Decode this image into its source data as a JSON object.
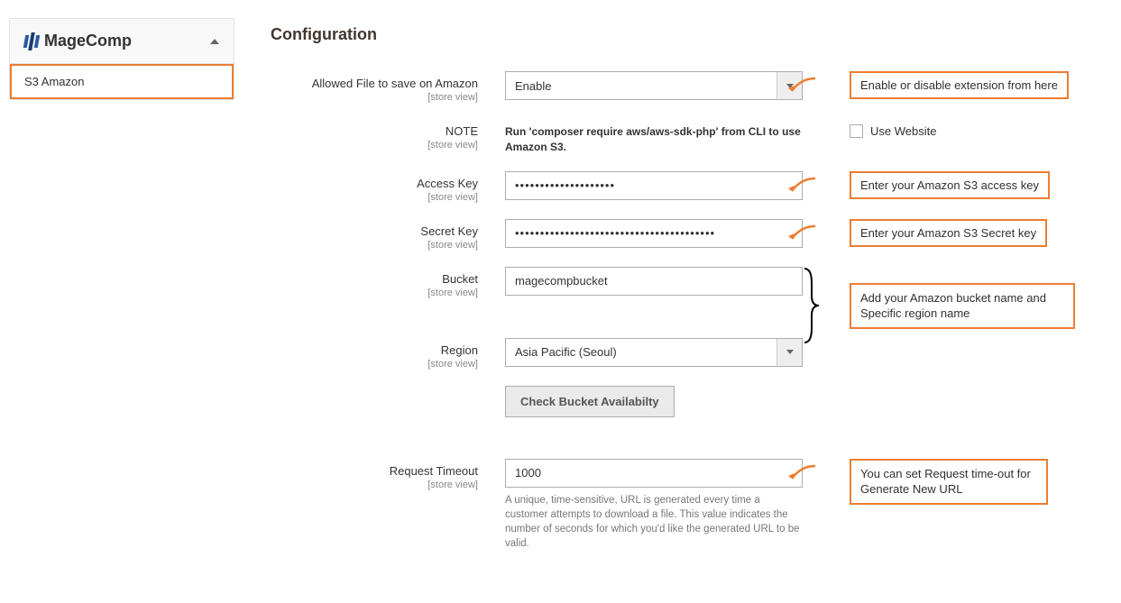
{
  "sidebar": {
    "brand_label": "MageComp",
    "items": [
      {
        "label": "S3 Amazon"
      }
    ]
  },
  "page": {
    "title": "Configuration"
  },
  "scope_text": "[store view]",
  "fields": {
    "allowed": {
      "label": "Allowed File to save on Amazon",
      "value": "Enable",
      "callout": "Enable or disable extension from here"
    },
    "note": {
      "label": "NOTE",
      "text": "Run 'composer require aws/aws-sdk-php' from CLI to use Amazon S3.",
      "use_website_label": "Use Website"
    },
    "access_key": {
      "label": "Access Key",
      "value": "••••••••••••••••••••",
      "callout": "Enter your Amazon S3 access key"
    },
    "secret_key": {
      "label": "Secret Key",
      "value": "••••••••••••••••••••••••••••••••••••••••",
      "callout": "Enter your Amazon S3 Secret key"
    },
    "bucket": {
      "label": "Bucket",
      "value": "magecompbucket"
    },
    "region": {
      "label": "Region",
      "value": "Asia Pacific (Seoul)"
    },
    "bucket_region_callout": "Add your Amazon bucket name and Specific region name",
    "check_button": "Check Bucket Availabilty",
    "timeout": {
      "label": "Request Timeout",
      "value": "1000",
      "help": "A unique, time-sensitive, URL is generated every time a customer attempts to download a file. This value indicates the number of seconds for which you'd like the generated URL to be valid.",
      "callout": "You can set Request time-out for Generate New URL"
    }
  }
}
